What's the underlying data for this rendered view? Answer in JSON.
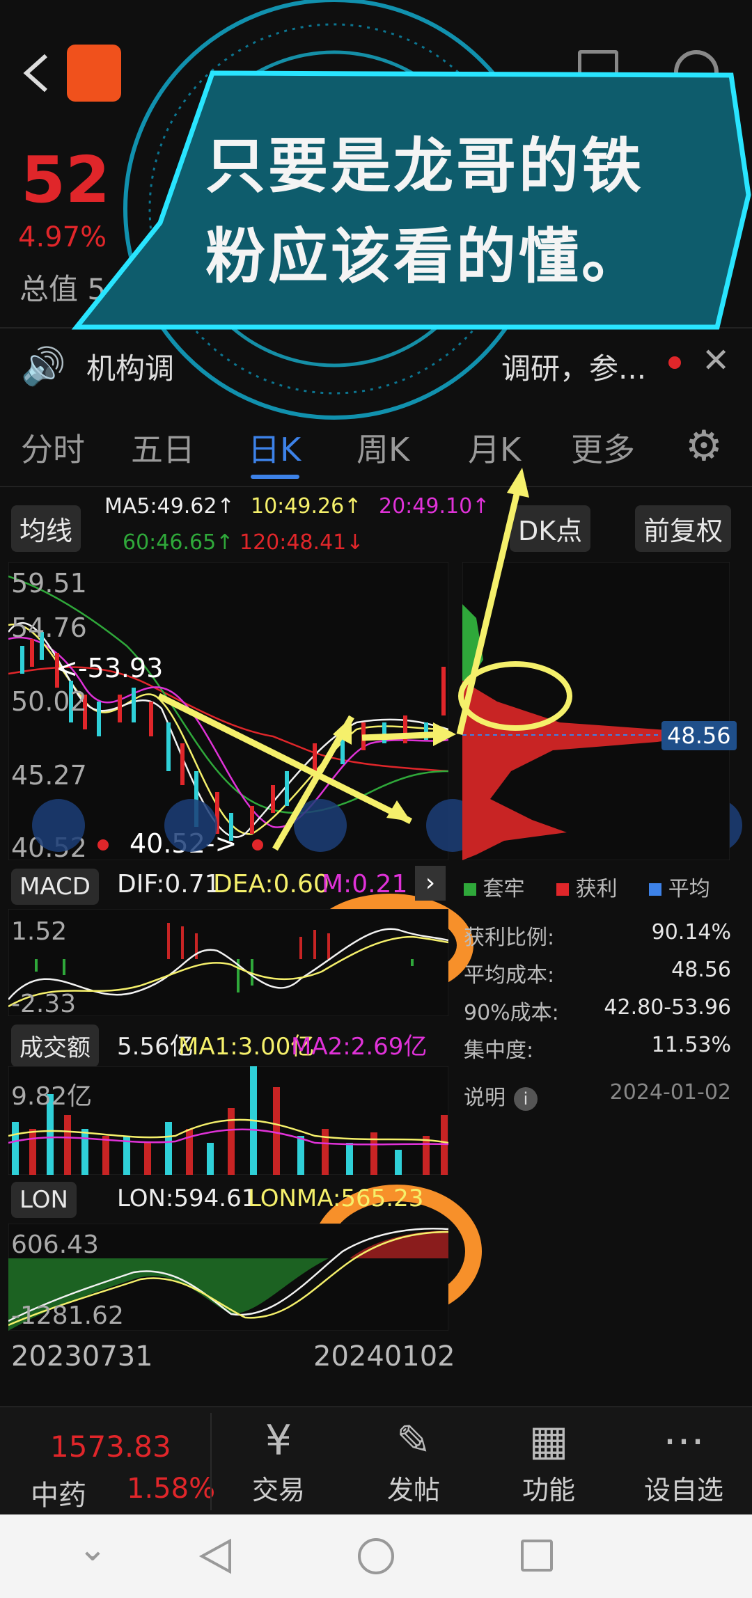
{
  "header": {
    "price_big": "52",
    "change_pct": "4.97%",
    "mkt_value": "总值 5"
  },
  "overlay": {
    "line1": "只要是龙哥的铁",
    "line2": "粉应该看的懂。"
  },
  "news": {
    "text": "机构调",
    "text2": "调研，参..."
  },
  "tabs": [
    "分时",
    "五日",
    "日K",
    "周K",
    "月K",
    "更多"
  ],
  "ma": {
    "selector": "均线",
    "ma5": "MA5:49.62↑",
    "ma10": "10:49.26↑",
    "ma20": "20:49.10↑",
    "ma60": "60:46.65↑",
    "ma120": "120:48.41↓",
    "dk": "DK点",
    "fq": "前复权"
  },
  "kline": {
    "y_labels": [
      "59.51",
      "54.76",
      "50.02",
      "45.27",
      "40.52"
    ],
    "annot_high": "<-53.93",
    "annot_low": "40.52->",
    "chip_price": "48.56"
  },
  "chip_legend": [
    "套牢",
    "获利",
    "平均"
  ],
  "macd": {
    "selector": "MACD",
    "dif": "DIF:0.71",
    "dea": "DEA:0.60",
    "m": "M:0.21",
    "y_top": "1.52",
    "y_bot": "-2.33"
  },
  "vol": {
    "selector": "成交额",
    "val": "5.56亿",
    "ma1": "MA1:3.00亿",
    "ma2": "MA2:2.69亿",
    "y_top": "9.82亿"
  },
  "lon": {
    "selector": "LON",
    "lon": "LON:594.61",
    "lonma": "LONMA:565.23",
    "y_top": "606.43",
    "y_bot": "-1281.62"
  },
  "dates": [
    "20230731",
    "20240102"
  ],
  "chips": {
    "profit_label": "获利比例:",
    "profit": "90.14%",
    "avg_label": "平均成本:",
    "avg": "48.56",
    "c90_label": "90%成本:",
    "c90": "42.80-53.96",
    "conc_label": "集中度:",
    "conc": "11.53%",
    "note": "说明",
    "date": "2024-01-02"
  },
  "bottom": {
    "index_val": "1573.83",
    "index_name": "中药",
    "index_pct": "1.58%",
    "trade": "交易",
    "post": "发帖",
    "func": "功能",
    "watch": "设自选"
  },
  "colors": {
    "up": "#e0262a",
    "down": "#2fd0d8",
    "accent": "#3d82e8",
    "yellow": "#f5f06b",
    "orange": "#f7902a"
  }
}
